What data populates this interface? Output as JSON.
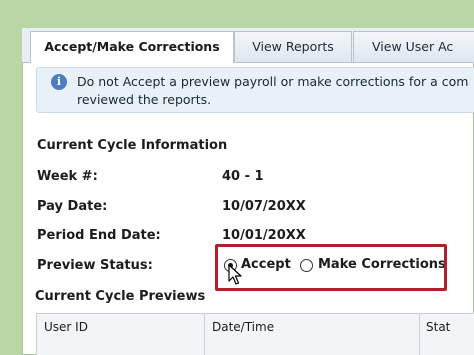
{
  "tabs": [
    {
      "label": "Accept/Make Corrections",
      "active": true
    },
    {
      "label": "View Reports",
      "active": false
    },
    {
      "label": "View User Ac",
      "active": false
    }
  ],
  "info_banner": {
    "icon": "info-icon",
    "line1": "Do not Accept a preview payroll or make corrections for a com",
    "line2": "reviewed the reports."
  },
  "current_cycle": {
    "title": "Current Cycle Information",
    "fields": [
      {
        "label": "Week #:",
        "value": "40 - 1"
      },
      {
        "label": "Pay Date:",
        "value": "10/07/20XX"
      },
      {
        "label": "Period End Date:",
        "value": "10/01/20XX"
      }
    ],
    "preview_status": {
      "label": "Preview Status:",
      "options": [
        {
          "label": "Accept",
          "selected": true
        },
        {
          "label": "Make Corrections",
          "selected": false
        }
      ]
    }
  },
  "previews": {
    "title": "Current Cycle Previews",
    "columns": [
      "User ID",
      "Date/Time",
      "Stat"
    ]
  },
  "colors": {
    "background": "#b9d7a5",
    "highlight_border": "#b0202a",
    "info_background": "#e8f0f8"
  }
}
